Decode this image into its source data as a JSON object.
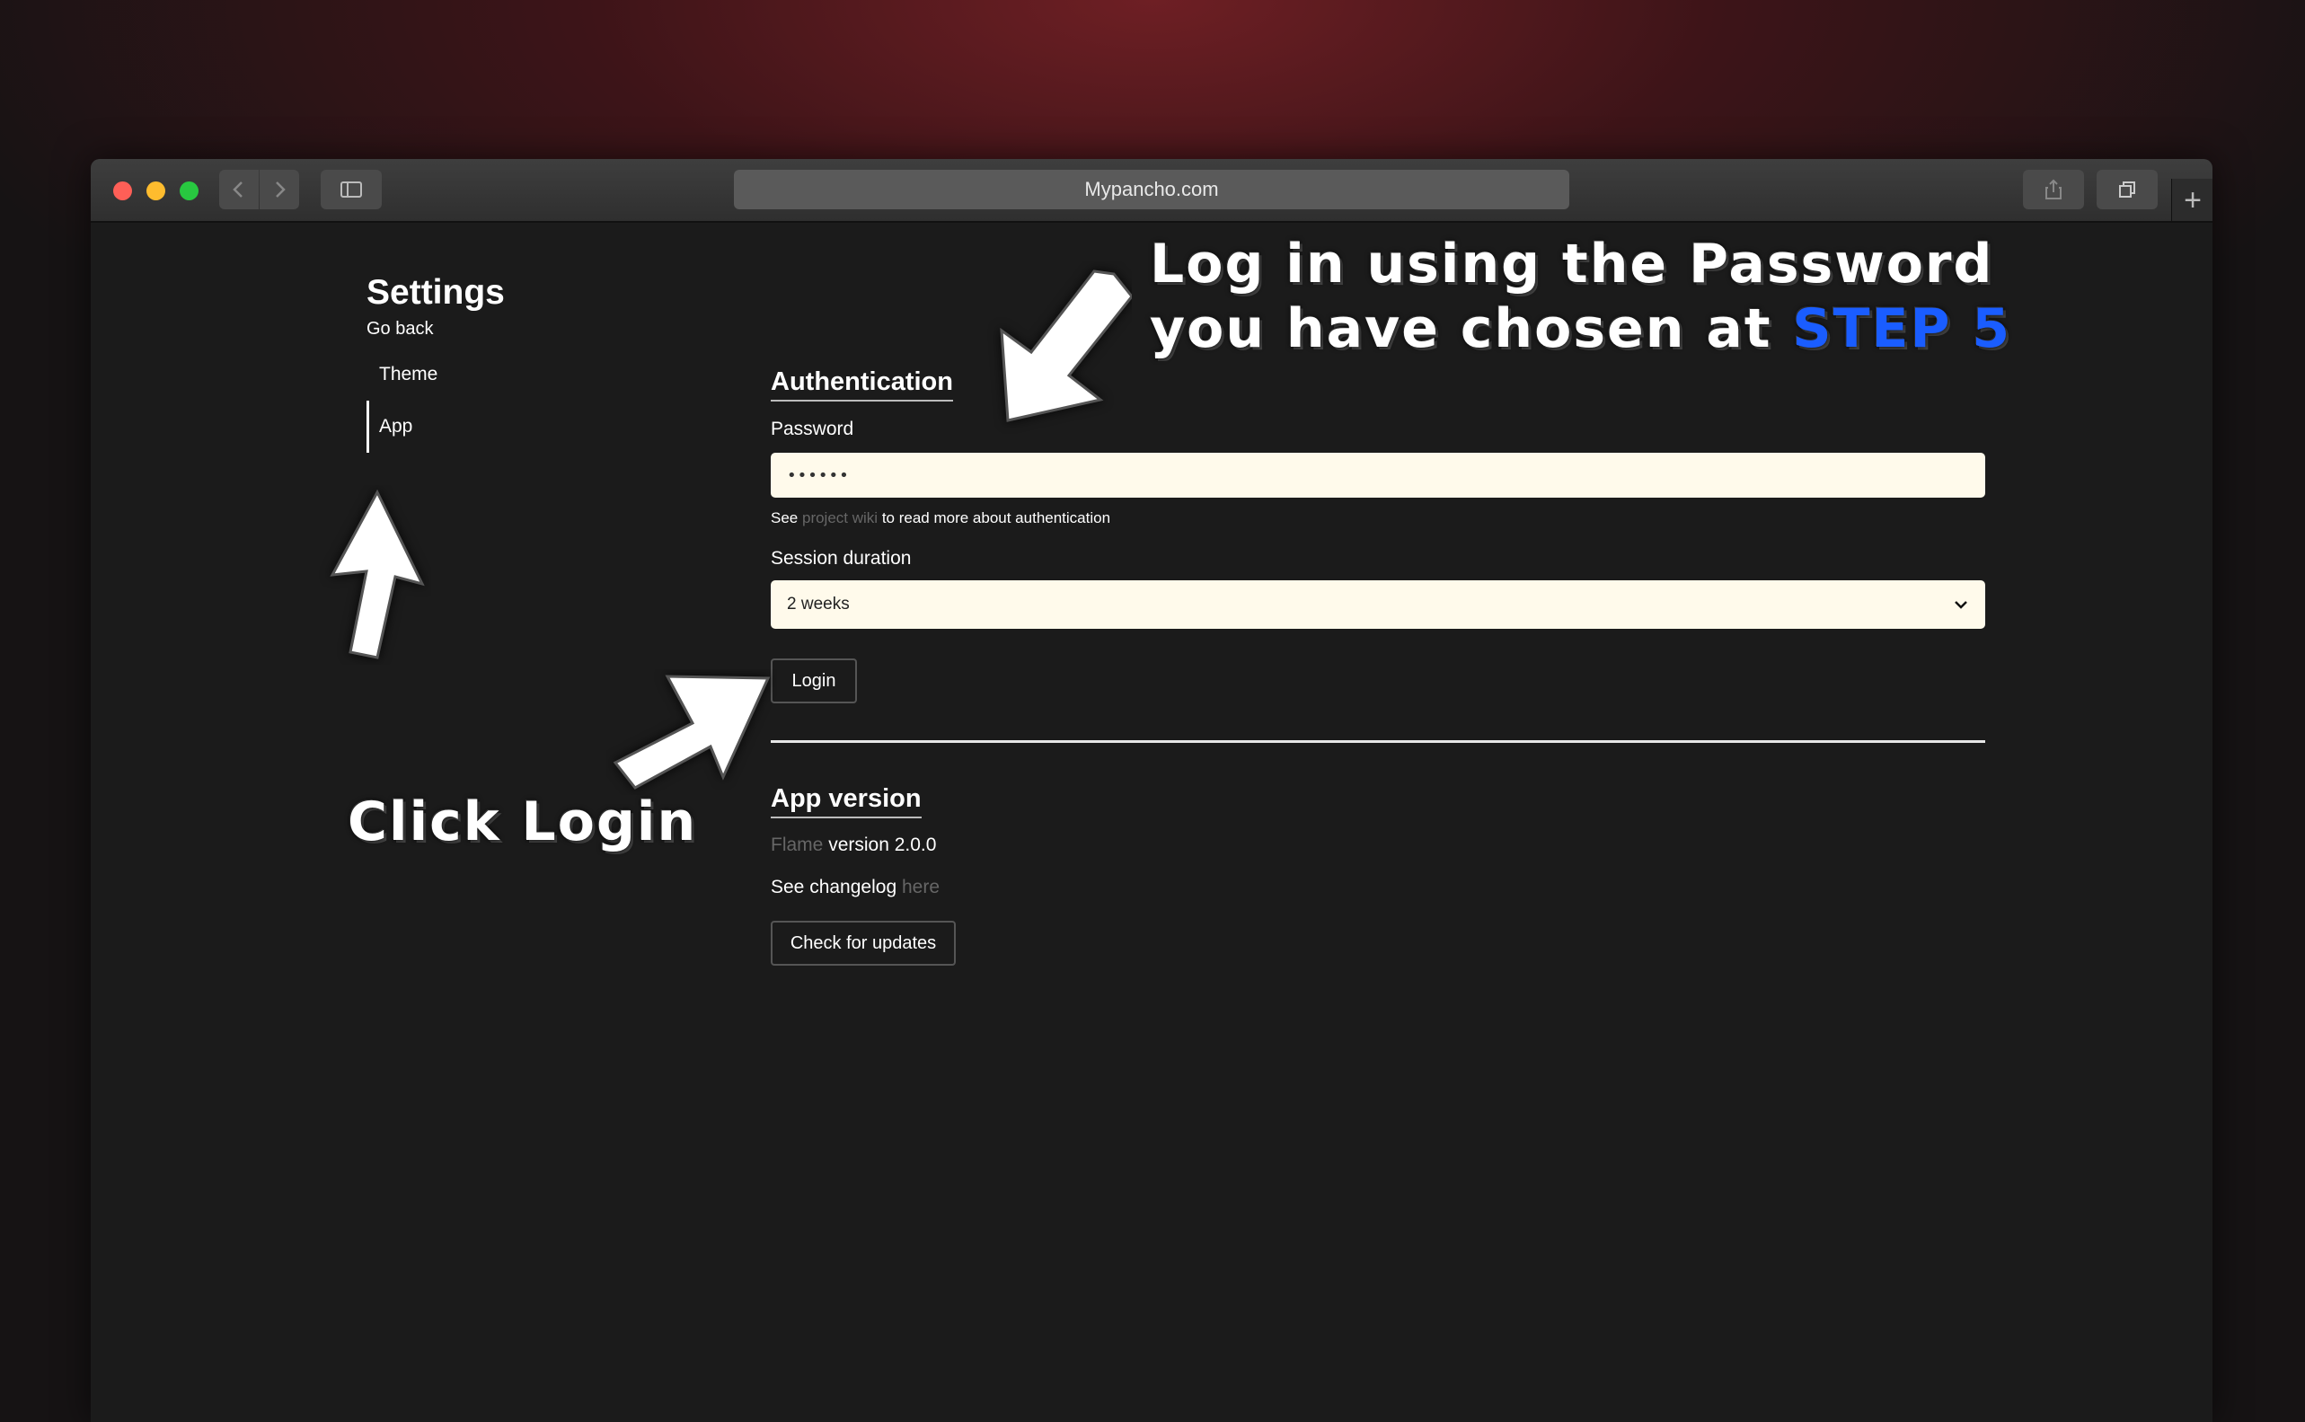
{
  "browser": {
    "url": "Mypancho.com",
    "new_tab_symbol": "+"
  },
  "sidebar": {
    "title": "Settings",
    "go_back": "Go back",
    "items": [
      {
        "label": "Theme",
        "active": false
      },
      {
        "label": "App",
        "active": true
      }
    ]
  },
  "authentication": {
    "heading": "Authentication",
    "password_label": "Password",
    "password_value": "••••••",
    "hint_prefix": "See",
    "hint_link": "project wiki",
    "hint_suffix": "to read more about authentication",
    "session_label": "Session duration",
    "session_value": "2 weeks",
    "login_button": "Login"
  },
  "app_version": {
    "heading": "App version",
    "app_name": "Flame",
    "version_text": "version 2.0.0",
    "changelog_prefix": "See changelog",
    "changelog_link": "here",
    "update_button": "Check for updates"
  },
  "annotations": {
    "top_line1": "Log in using the Password",
    "top_line2": "you have chosen at",
    "top_step": "STEP 5",
    "left": "Click Login"
  },
  "colors": {
    "accent_step": "#1a5dff",
    "input_bg": "#fffaeb",
    "page_bg": "#1b1b1b"
  }
}
